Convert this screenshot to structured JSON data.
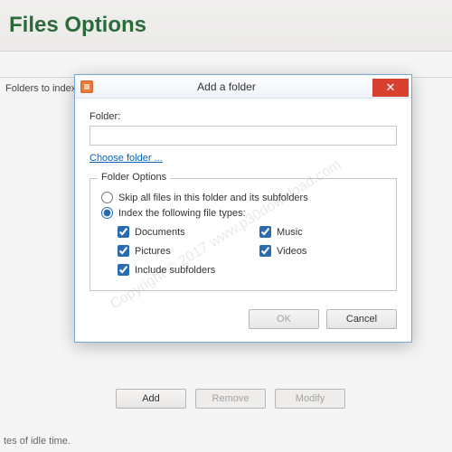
{
  "header": {
    "title": "Files Options"
  },
  "sidebar": {
    "folders_to_index_label": "Folders to index"
  },
  "buttons": {
    "add": "Add",
    "remove": "Remove",
    "modify": "Modify"
  },
  "status": {
    "idle_note": "tes of idle time."
  },
  "dialog": {
    "title": "Add a folder",
    "folder_label": "Folder:",
    "folder_value": "",
    "choose_link": "Choose folder ...",
    "options_legend": "Folder Options",
    "radio_skip": "Skip all files in this folder and its subfolders",
    "radio_index": "Index the following file types:",
    "checks": {
      "documents": "Documents",
      "music": "Music",
      "pictures": "Pictures",
      "videos": "Videos",
      "include_subfolders": "Include subfolders"
    },
    "ok": "OK",
    "cancel": "Cancel"
  },
  "watermark": "Copyright © 2017   www.p30download.com"
}
